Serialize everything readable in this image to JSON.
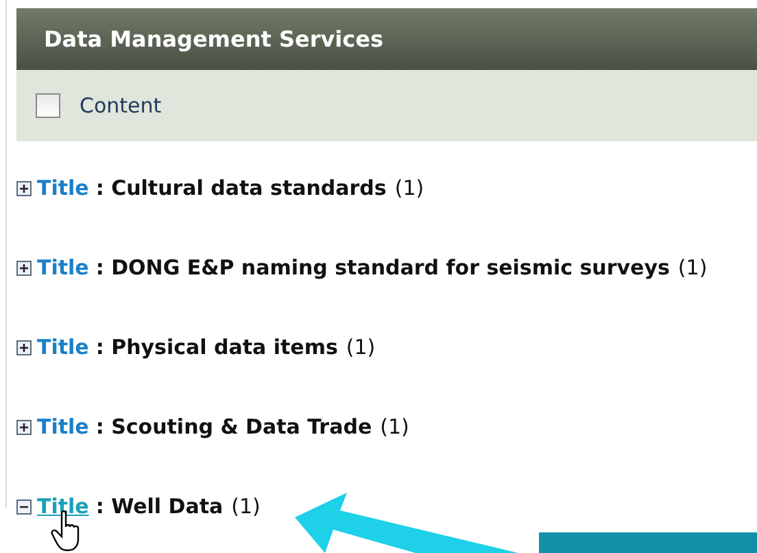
{
  "panel": {
    "title": "Data Management Services"
  },
  "select_all": {
    "label": "Content",
    "checked": false
  },
  "groups": [
    {
      "field": "Title",
      "separator": ":",
      "value": "Cultural data standards",
      "count": "(1)",
      "expanded": false,
      "hovered": false
    },
    {
      "field": "Title",
      "separator": ":",
      "value": "DONG E&P naming standard for seismic surveys",
      "count": "(1)",
      "expanded": false,
      "hovered": false
    },
    {
      "field": "Title",
      "separator": ":",
      "value": "Physical data items",
      "count": "(1)",
      "expanded": false,
      "hovered": false
    },
    {
      "field": "Title",
      "separator": ":",
      "value": "Scouting & Data Trade",
      "count": "(1)",
      "expanded": false,
      "hovered": false
    },
    {
      "field": "Title",
      "separator": ":",
      "value": "Well Data",
      "count": "(1)",
      "expanded": true,
      "hovered": true
    }
  ]
}
